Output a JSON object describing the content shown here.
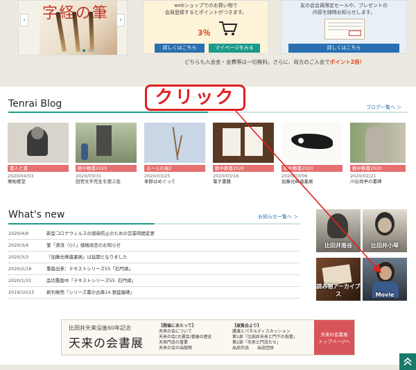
{
  "carousel": {
    "calligraphy": "字経の筆",
    "prev": "‹",
    "next": "›"
  },
  "shop_card": {
    "line1": "webショップでのお買い物で",
    "line2": "会員登録するとポイントがつきます。",
    "percent": "3％",
    "btn_left": "詳しくはこちら",
    "btn_right": "マイページをみる"
  },
  "member_card": {
    "line1": "友の会会員限定セールや、プレゼントの",
    "line2": "内容を随時お知らせします。",
    "btn": "詳しくはこちら"
  },
  "notice": {
    "text": "どちらも入会金・会費等は一切無料。さらに、両方のご入会で",
    "highlight": "ポイント2倍！"
  },
  "blog": {
    "title": "Tenrai Blog",
    "more": "ブログ一覧へ ＞",
    "items": [
      {
        "tag": "書人と書",
        "date": "2020/04/03",
        "title": "栗柏樫堂"
      },
      {
        "tag": "静中静書2020",
        "date": "2020/03/31",
        "title": "田宮文平先生を偲ぶ会"
      },
      {
        "tag": "るーらの風2",
        "date": "2020/03/25",
        "title": "季節はめぐって"
      },
      {
        "tag": "静中静書2020",
        "date": "2020/03/16",
        "title": "電子書籍"
      },
      {
        "tag": "静中静書2020",
        "date": "2020/03/06",
        "title": "加藤光峰遺墨展"
      },
      {
        "tag": "静中静書2020",
        "date": "2020/02/21",
        "title": "川谷尚亭の書碑"
      }
    ]
  },
  "news": {
    "title": "What's new",
    "more": "お知らせ一覧へ ＞",
    "items": [
      {
        "date": "2020/4/8",
        "text": "新型コロナウィルスの感染防止のための営業時間変更"
      },
      {
        "date": "2020/3/4",
        "text": "筆「清流（小）」価格改定のお知らせ"
      },
      {
        "date": "2020/3/3",
        "text": "『加藤光峰遺墨展』は延期となりました"
      },
      {
        "date": "2020/2/18",
        "text": "重版出来：テキストシリーズ55「石門頌」"
      },
      {
        "date": "2020/1/31",
        "text": "品切重版中『テキストシリーズ55. 石門頌』"
      },
      {
        "date": "2019/10/15",
        "text": "新刊発売『シリーズ書の古典14.張猛龍碑』"
      }
    ]
  },
  "tiles": [
    {
      "label": "比田井南谷"
    },
    {
      "label": "比田井小琴"
    },
    {
      "label": "読み物アーカイブス"
    },
    {
      "label": "Movie"
    }
  ],
  "banner": {
    "sub": "比田井天来没後80年記念",
    "main": "天来の会書展",
    "col1_head": "【開催にあたって】",
    "col1": [
      "天来の会について",
      "天来の会(大運会)書展の歴史",
      "天来門流の書業",
      "天来の会の出版物"
    ],
    "col2_head": "【展覧会より】",
    "col2": [
      "講演とパネルディスカッション",
      "第1部「比田井天来と門下の指書」",
      "第2部「天来と門流たち」",
      "出品作品　　出品団体"
    ],
    "right": "天来の会書展\nトップページへ"
  },
  "annotation": {
    "text": "クリック"
  },
  "colors": {
    "accent": "#1a9a8a",
    "tag": "#e66f6f",
    "arrow": "#e02020"
  }
}
